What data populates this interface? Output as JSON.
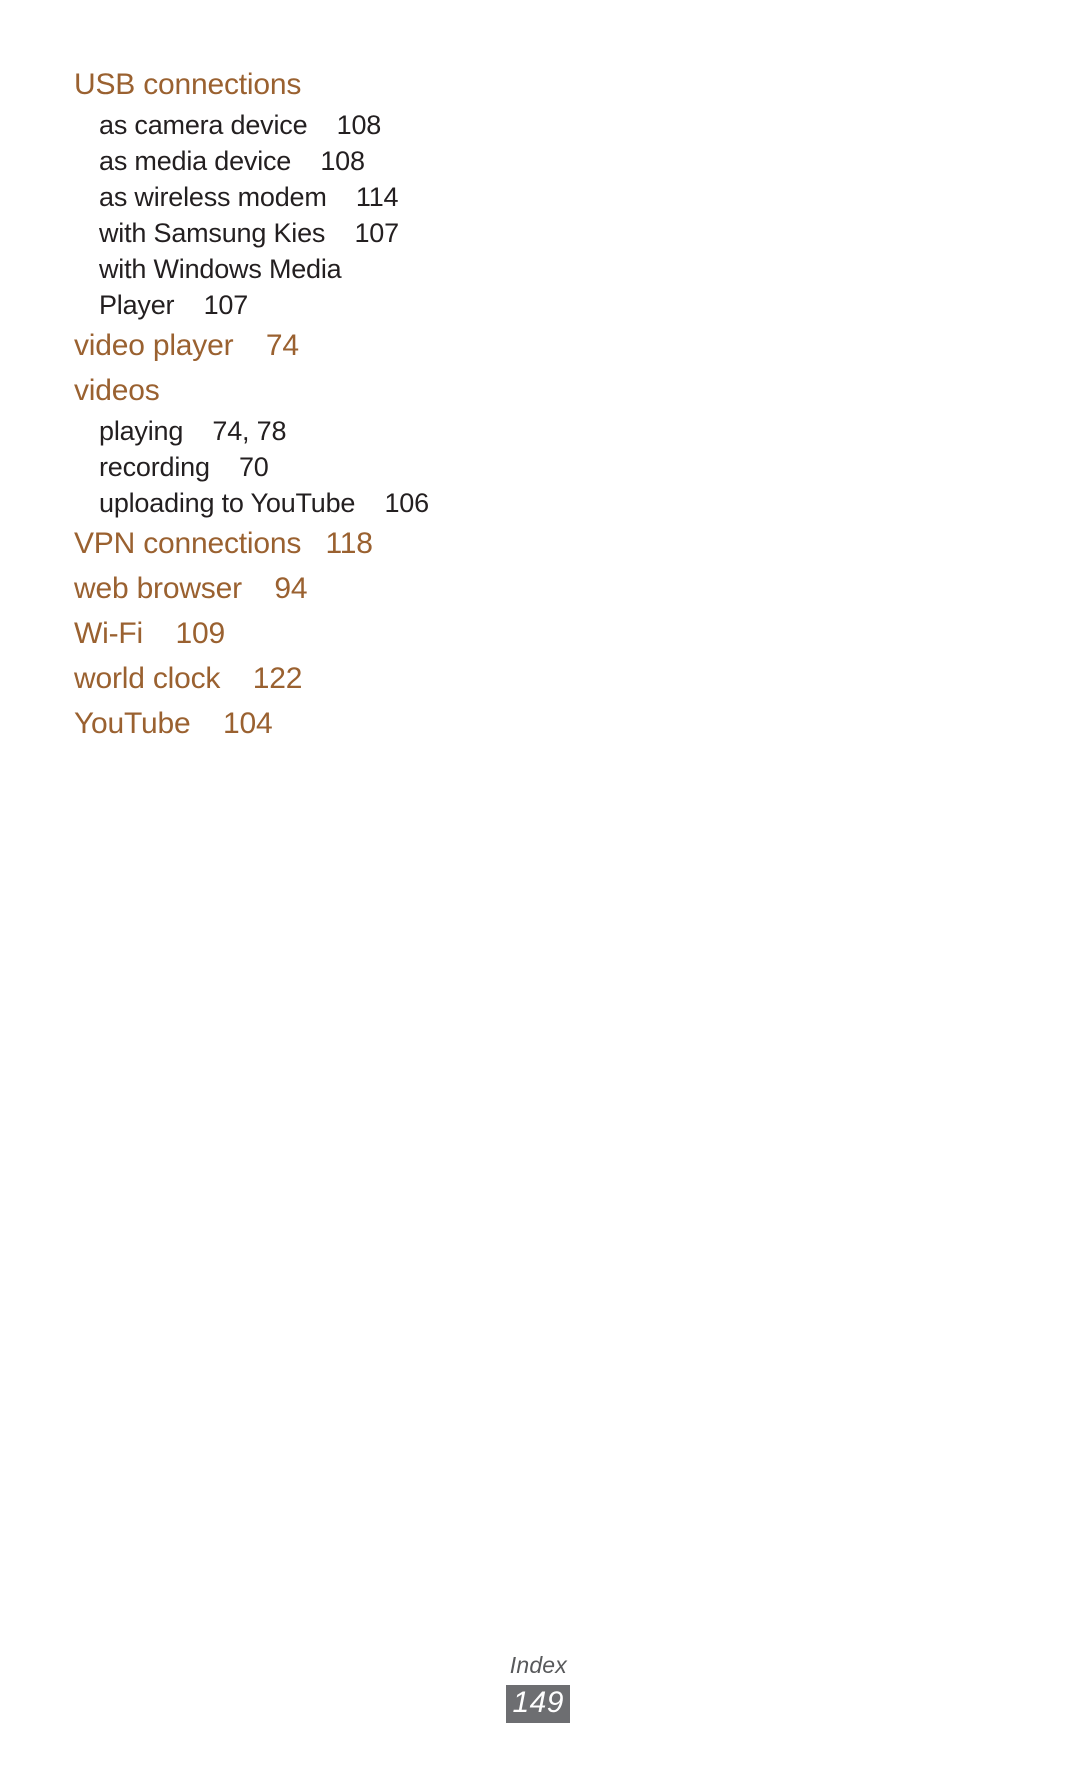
{
  "page": {
    "footer_label": "Index",
    "page_number": "149",
    "heading_color": "#9a6130",
    "subentry_color": "#231f20",
    "page_box_color": "#6d6e71",
    "background_color": "#ffffff"
  },
  "index": {
    "entries": [
      {
        "type": "main",
        "term": "USB connections",
        "pages": "",
        "subentries": [
          {
            "term": "as camera device",
            "pages": "108"
          },
          {
            "term": "as media device",
            "pages": "108"
          },
          {
            "term": "as wireless modem",
            "pages": "114"
          },
          {
            "term": "with Samsung Kies",
            "pages": "107"
          },
          {
            "term": "with Windows Media",
            "pages": ""
          },
          {
            "term": "Player",
            "pages": "107"
          }
        ]
      },
      {
        "type": "main",
        "term": "video player",
        "pages": "74",
        "subentries": []
      },
      {
        "type": "main",
        "term": "videos",
        "pages": "",
        "subentries": [
          {
            "term": "playing",
            "pages": "74, 78"
          },
          {
            "term": "recording",
            "pages": "70"
          },
          {
            "term": "uploading to YouTube",
            "pages": "106"
          }
        ]
      },
      {
        "type": "main",
        "term": "VPN connections",
        "pages": "118",
        "subentries": []
      },
      {
        "type": "main",
        "term": "web browser",
        "pages": "94",
        "subentries": []
      },
      {
        "type": "main",
        "term": "Wi-Fi",
        "pages": "109",
        "subentries": []
      },
      {
        "type": "main",
        "term": "world clock",
        "pages": "122",
        "subentries": []
      },
      {
        "type": "main",
        "term": "YouTube",
        "pages": "104",
        "subentries": []
      }
    ]
  }
}
